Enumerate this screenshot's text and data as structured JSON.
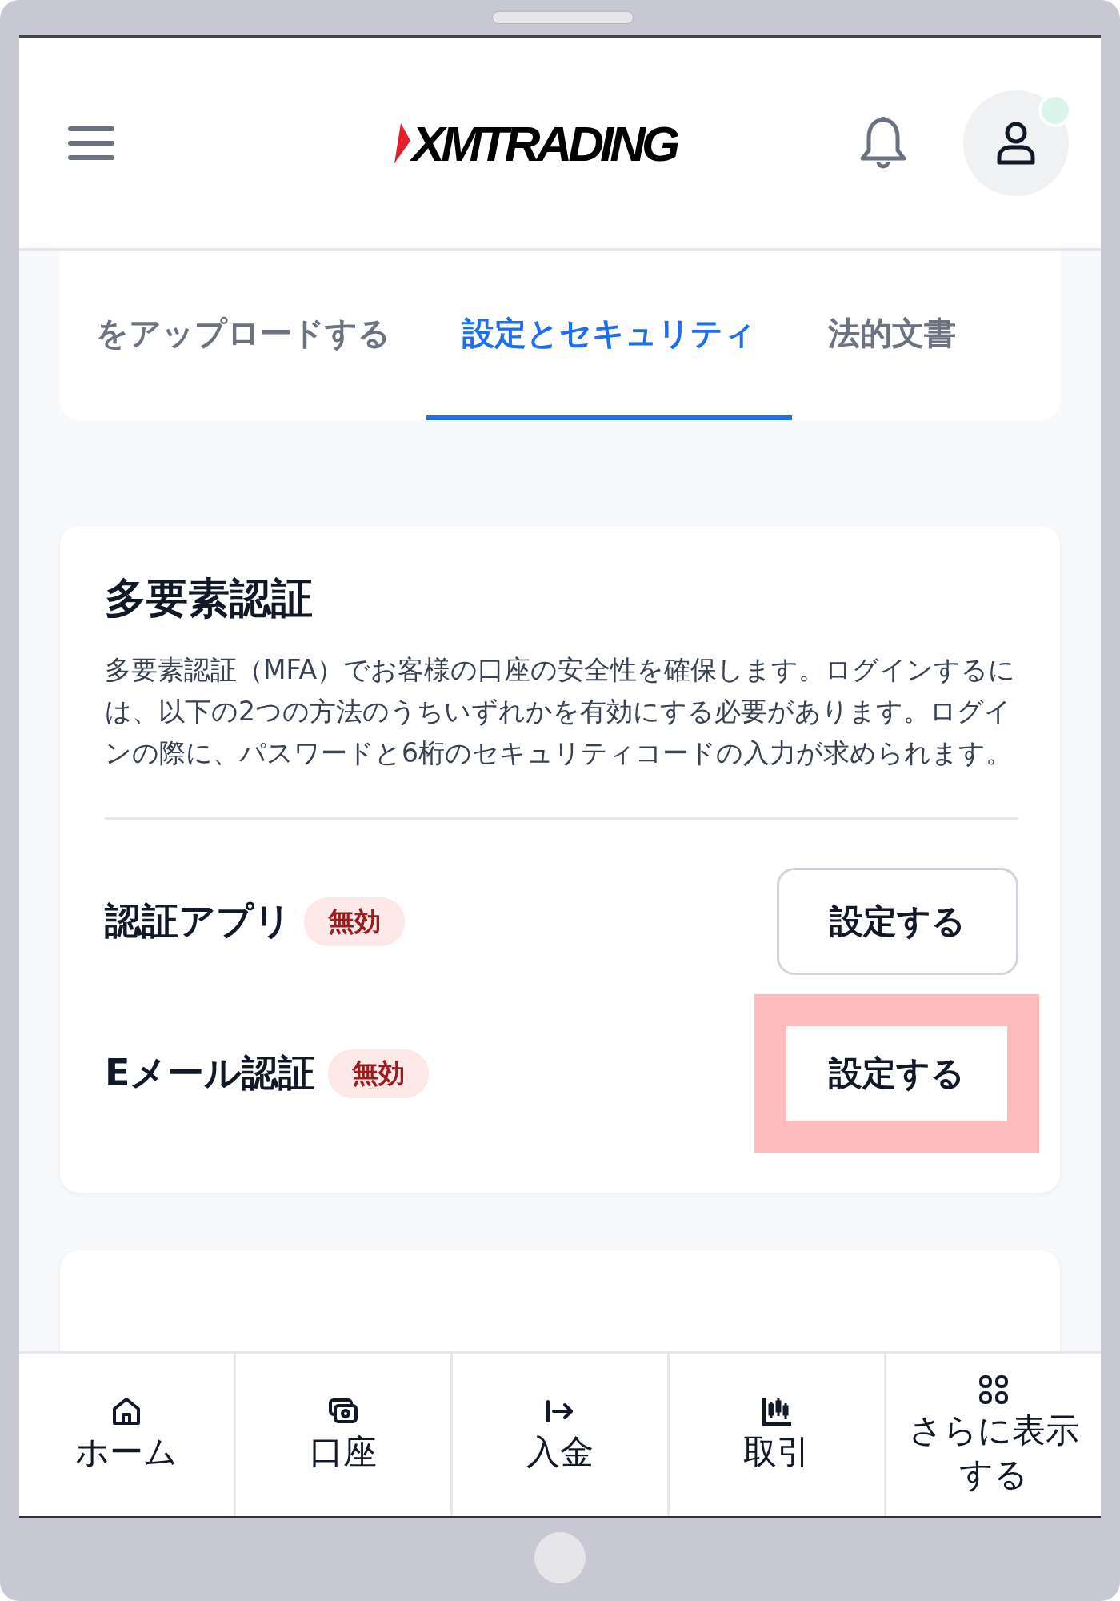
{
  "header": {
    "logo": "XMTRADING",
    "notification_dot": true
  },
  "tabs": [
    {
      "label": "をアップロードする",
      "selected": false
    },
    {
      "label": "設定とセキュリティ",
      "selected": true
    },
    {
      "label": "法的文書",
      "selected": false
    }
  ],
  "mfa": {
    "title": "多要素認証",
    "description": "多要素認証（MFA）でお客様の口座の安全性を確保します。ログインするには、以下の2つの方法のうちいずれかを有効にする必要があります。ログインの際に、パスワードと6桁のセキュリティコードの入力が求められます。",
    "methods": [
      {
        "name": "認証アプリ",
        "status": "無効",
        "button": "設定する",
        "highlighted": false
      },
      {
        "name": "Eメール認証",
        "status": "無効",
        "button": "設定する",
        "highlighted": true
      }
    ]
  },
  "bottom_nav": [
    {
      "kind": "home",
      "label": "ホーム"
    },
    {
      "kind": "account",
      "label": "口座"
    },
    {
      "kind": "deposit",
      "label": "入金"
    },
    {
      "kind": "trade",
      "label": "取引"
    },
    {
      "kind": "more",
      "label": "さらに表示する"
    }
  ]
}
